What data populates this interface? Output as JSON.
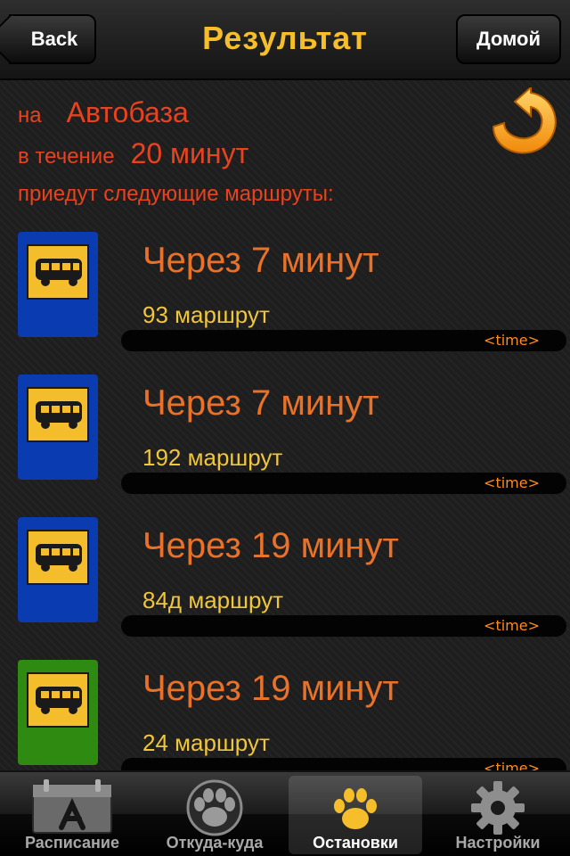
{
  "navbar": {
    "title": "Результат",
    "back_label": "Back",
    "home_label": "Домой"
  },
  "info": {
    "stop_prefix": "на",
    "stop_name": "Автобаза",
    "period_prefix": "в течение",
    "period_value": "20 минут",
    "routes_caption": "приедут следующие маршруты:",
    "refresh_icon": "refresh-arrow-icon"
  },
  "routes": [
    {
      "eta": "Через 7 минут",
      "name": "93 маршрут",
      "time": "<time>",
      "sign_color": "#0a3bb0",
      "icon": "bus-stop-icon"
    },
    {
      "eta": "Через 7 минут",
      "name": "192 маршрут",
      "time": "<time>",
      "sign_color": "#0a3bb0",
      "icon": "bus-stop-icon"
    },
    {
      "eta": "Через 19 минут",
      "name": "84д маршрут",
      "time": "<time>",
      "sign_color": "#0a3bb0",
      "icon": "bus-stop-icon"
    },
    {
      "eta": "Через 19 минут",
      "name": "24 маршрут",
      "time": "<time>",
      "sign_color": "#2f8a12",
      "icon": "bus-stop-icon"
    }
  ],
  "tabs": [
    {
      "label": "Расписание",
      "icon": "calendar-icon",
      "selected": false
    },
    {
      "label": "Откуда-куда",
      "icon": "paw-icon",
      "selected": false
    },
    {
      "label": "Остановки",
      "icon": "paw-icon",
      "selected": true
    },
    {
      "label": "Настройки",
      "icon": "gear-icon",
      "selected": false
    }
  ],
  "colors": {
    "accent_yellow": "#f5be2a",
    "accent_red": "#e8431e",
    "eta_orange": "#e8722a"
  }
}
